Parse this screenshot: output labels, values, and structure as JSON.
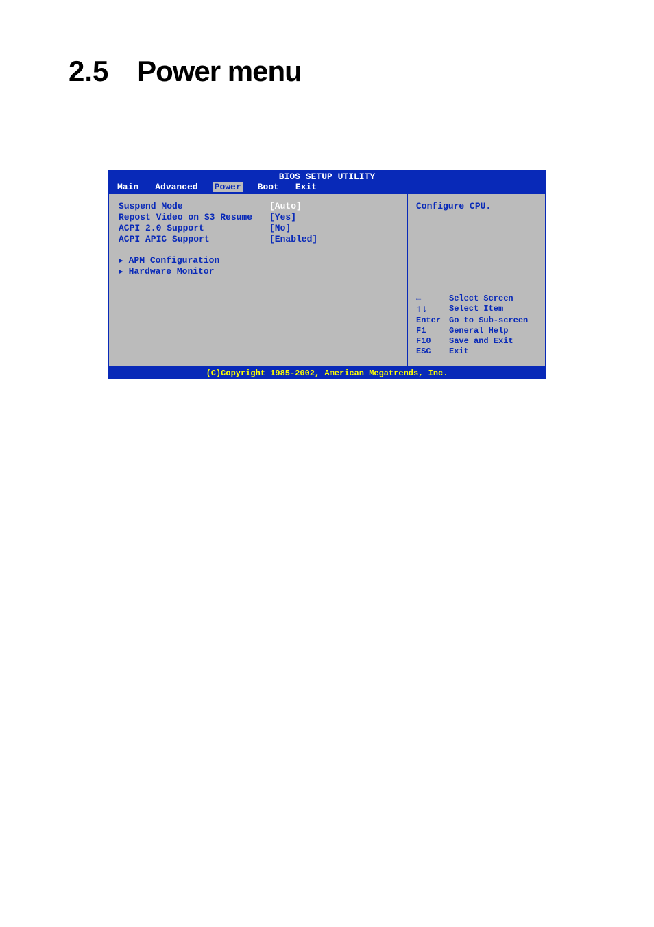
{
  "page": {
    "section_number": "2.5",
    "title": "Power menu"
  },
  "bios": {
    "header": "BIOS SETUP UTILITY",
    "tabs": {
      "main": "Main",
      "advanced": "Advanced",
      "power": "Power",
      "boot": "Boot",
      "exit": "Exit"
    },
    "settings": {
      "suspend_mode": {
        "label": "Suspend Mode",
        "value": "[Auto]"
      },
      "repost_video": {
        "label": "Repost Video on S3 Resume",
        "value": "[Yes]"
      },
      "acpi_20": {
        "label": "ACPI 2.0 Support",
        "value": "[No]"
      },
      "acpi_apic": {
        "label": "ACPI APIC Support",
        "value": "[Enabled]"
      }
    },
    "submenus": {
      "apm": "APM Configuration",
      "hardware": "Hardware Monitor"
    },
    "help": {
      "text": "Configure CPU."
    },
    "nav": {
      "select_screen": "Select Screen",
      "select_item": "Select Item",
      "enter_key": "Enter",
      "enter_action": "Go to Sub-screen",
      "f1_key": "F1",
      "f1_action": "General Help",
      "f10_key": "F10",
      "f10_action": "Save and Exit",
      "esc_key": "ESC",
      "esc_action": "Exit"
    },
    "footer": "(C)Copyright 1985-2002, American Megatrends, Inc."
  }
}
